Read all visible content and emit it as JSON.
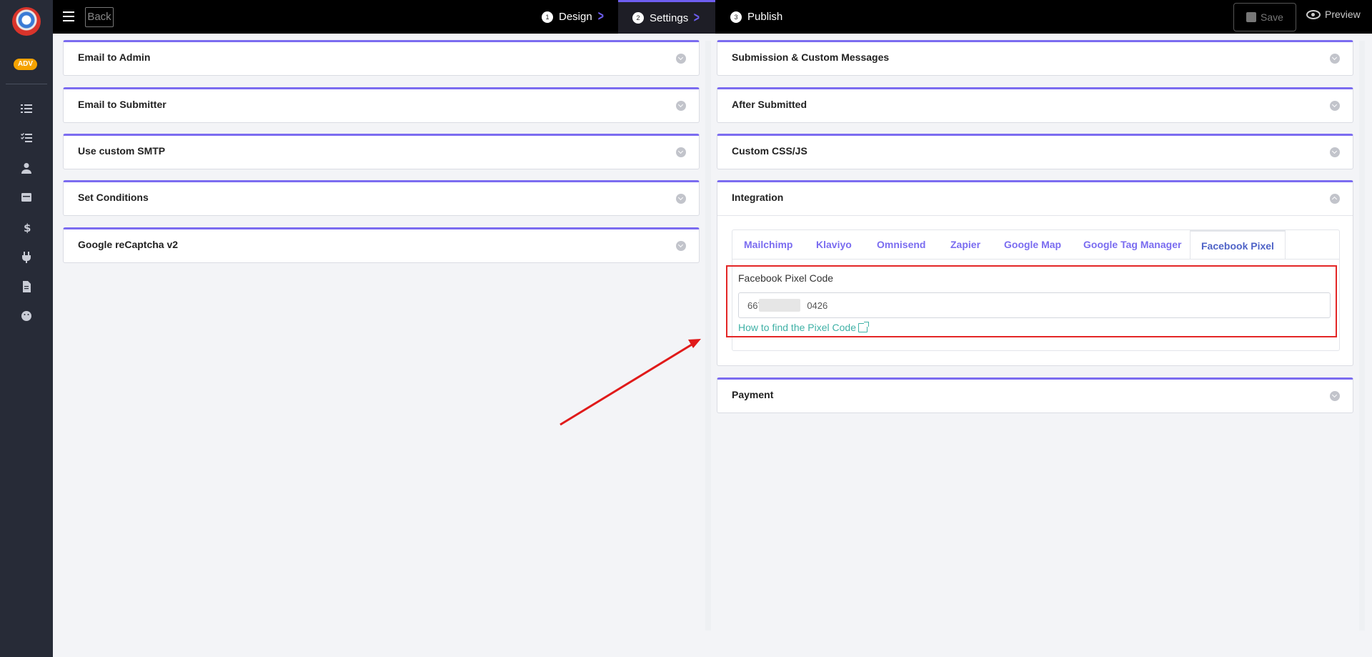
{
  "topbar": {
    "back_label": "Back",
    "steps": [
      {
        "num": "1",
        "label": "Design"
      },
      {
        "num": "2",
        "label": "Settings"
      },
      {
        "num": "3",
        "label": "Publish"
      }
    ],
    "active_step": "Settings",
    "save_label": "Save",
    "preview_label": "Preview"
  },
  "sidebar": {
    "badge": "ADV",
    "icons": [
      "list-icon",
      "checklist-icon",
      "user-icon",
      "inbox-icon",
      "dollar-icon",
      "plug-icon",
      "document-icon",
      "smile-icon"
    ]
  },
  "left_panels": [
    {
      "title": "Email to Admin"
    },
    {
      "title": "Email to Submitter"
    },
    {
      "title": "Use custom SMTP"
    },
    {
      "title": "Set Conditions"
    },
    {
      "title": "Google reCaptcha v2"
    }
  ],
  "right_panels": [
    {
      "title": "Submission & Custom Messages"
    },
    {
      "title": "After Submitted"
    },
    {
      "title": "Custom CSS/JS"
    }
  ],
  "integration": {
    "title": "Integration",
    "tabs": [
      "Mailchimp",
      "Klaviyo",
      "Omnisend",
      "Zapier",
      "Google Map",
      "Google Tag Manager",
      "Facebook Pixel"
    ],
    "active_tab": "Facebook Pixel",
    "field_label": "Facebook Pixel Code",
    "field_value": "667.",
    "field_value_tail": "0426",
    "help_link": "How to find the Pixel Code"
  },
  "payment": {
    "title": "Payment"
  },
  "colors": {
    "accent": "#7b6cf0",
    "highlight": "#e32626",
    "link": "#3fb1a6",
    "sidebar": "#272b37"
  }
}
